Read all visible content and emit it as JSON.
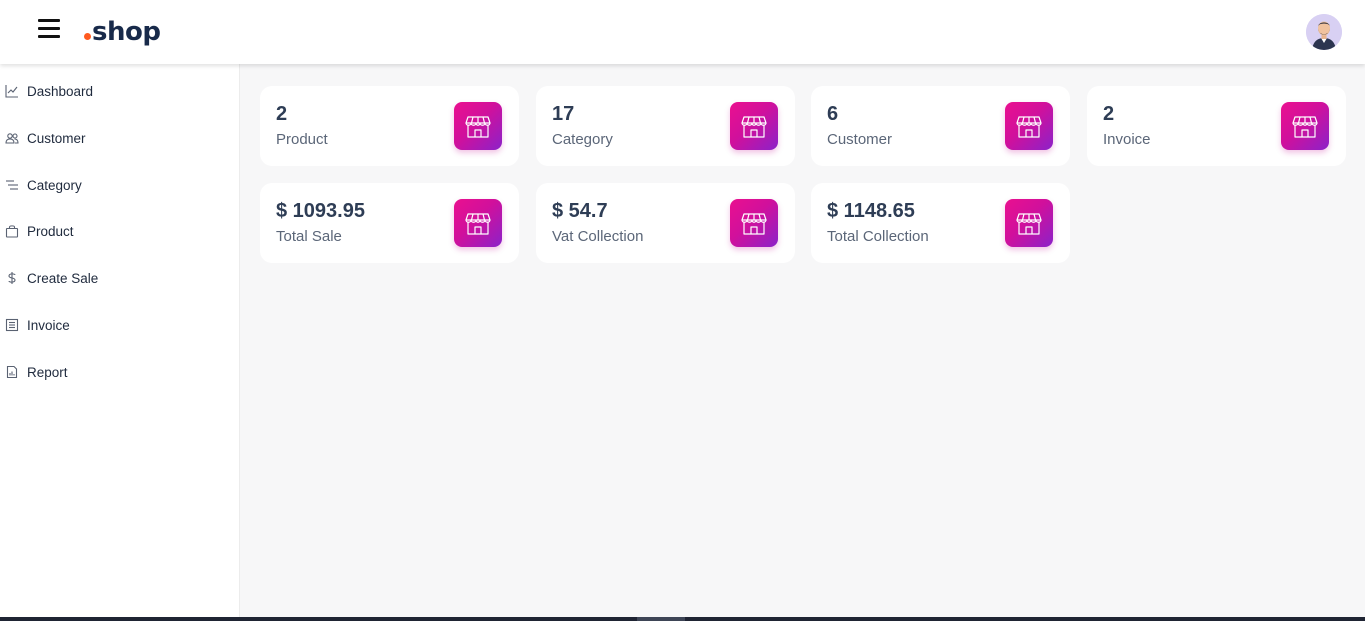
{
  "brand": {
    "name": "shop",
    "dot_color": "#ff5a1f",
    "accent": "#e0119a"
  },
  "header": {
    "menu_icon": "hamburger-icon",
    "avatar_icon": "user-avatar"
  },
  "sidebar": {
    "items": [
      {
        "label": "Dashboard",
        "icon": "chart-line-icon"
      },
      {
        "label": "Customer",
        "icon": "users-icon"
      },
      {
        "label": "Category",
        "icon": "list-icon"
      },
      {
        "label": "Product",
        "icon": "bag-icon"
      },
      {
        "label": "Create Sale",
        "icon": "dollar-icon"
      },
      {
        "label": "Invoice",
        "icon": "document-icon"
      },
      {
        "label": "Report",
        "icon": "report-icon"
      }
    ]
  },
  "stats": [
    {
      "value": "2",
      "label": "Product",
      "icon": "store-icon"
    },
    {
      "value": "17",
      "label": "Category",
      "icon": "store-icon"
    },
    {
      "value": "6",
      "label": "Customer",
      "icon": "store-icon"
    },
    {
      "value": "2",
      "label": "Invoice",
      "icon": "store-icon"
    },
    {
      "value": "$ 1093.95",
      "label": "Total Sale",
      "icon": "store-icon"
    },
    {
      "value": "$ 54.7",
      "label": "Vat Collection",
      "icon": "store-icon"
    },
    {
      "value": "$ 1148.65",
      "label": "Total Collection",
      "icon": "store-icon"
    }
  ]
}
